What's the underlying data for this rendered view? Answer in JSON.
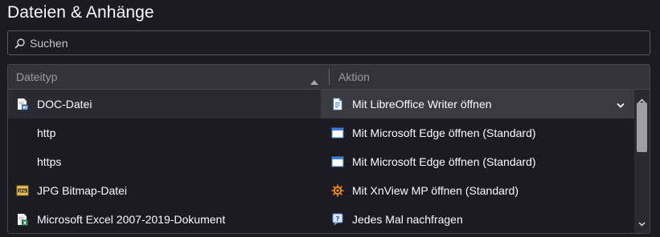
{
  "page": {
    "title": "Dateien & Anhänge"
  },
  "search": {
    "placeholder": "Suchen",
    "icon": "search-icon"
  },
  "table": {
    "columns": {
      "type": "Dateityp",
      "action": "Aktion"
    },
    "sort": {
      "column": "type",
      "direction": "ascending"
    },
    "rows": [
      {
        "type": "DOC-Datei",
        "type_icon": "word-document-icon",
        "action": "Mit LibreOffice Writer öffnen",
        "action_icon": "libreoffice-writer-icon",
        "selected": true
      },
      {
        "type": "http",
        "type_icon": "",
        "action": "Mit Microsoft Edge öffnen (Standard)",
        "action_icon": "application-window-icon",
        "selected": false
      },
      {
        "type": "https",
        "type_icon": "",
        "action": "Mit Microsoft Edge öffnen (Standard)",
        "action_icon": "application-window-icon",
        "selected": false
      },
      {
        "type": "JPG Bitmap-Datei",
        "type_icon": "jpg-image-icon",
        "action": "Mit XnView MP öffnen (Standard)",
        "action_icon": "xnview-icon",
        "selected": false
      },
      {
        "type": "Microsoft Excel 2007-2019-Dokument",
        "type_icon": "excel-document-icon",
        "action": "Jedes Mal nachfragen",
        "action_icon": "ask-question-icon",
        "selected": false
      }
    ]
  },
  "colors": {
    "background": "#1c1b22",
    "text": "#fbfbfe",
    "header": "#34333a",
    "selected_row": "#2b2a33",
    "scrollbar_thumb": "#9f9ea4"
  }
}
